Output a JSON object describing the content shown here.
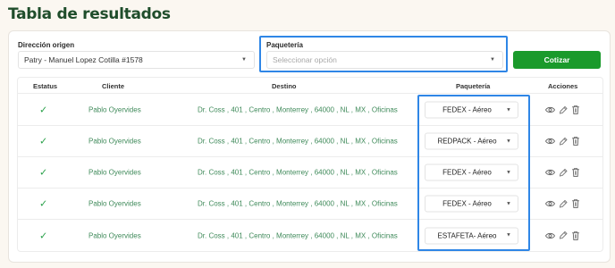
{
  "page": {
    "title": "Tabla de resultados"
  },
  "form": {
    "origin_label": "Dirección origen",
    "origin_value": "Patry - Manuel Lopez Cotilla #1578",
    "package_label": "Paquetería",
    "package_placeholder": "Seleccionar opción",
    "quote_button": "Cotizar"
  },
  "table": {
    "headers": {
      "status": "Estatus",
      "client": "Cliente",
      "destination": "Destino",
      "package": "Paquetería",
      "actions": "Acciones"
    },
    "rows": [
      {
        "status_icon": "check-icon",
        "client": "Pablo Oyervides",
        "destination": "Dr. Coss , 401 , Centro , Monterrey , 64000 , NL , MX , Oficinas",
        "package": "FEDEX - Aéreo"
      },
      {
        "status_icon": "check-icon",
        "client": "Pablo Oyervides",
        "destination": "Dr. Coss , 401 , Centro , Monterrey , 64000 , NL , MX , Oficinas",
        "package": "REDPACK - Aéreo"
      },
      {
        "status_icon": "check-icon",
        "client": "Pablo Oyervides",
        "destination": "Dr. Coss , 401 , Centro , Monterrey , 64000 , NL , MX , Oficinas",
        "package": "FEDEX - Aéreo"
      },
      {
        "status_icon": "check-icon",
        "client": "Pablo Oyervides",
        "destination": "Dr. Coss , 401 , Centro , Monterrey , 64000 , NL , MX , Oficinas",
        "package": "FEDEX - Aéreo"
      },
      {
        "status_icon": "check-icon",
        "client": "Pablo Oyervides",
        "destination": "Dr. Coss , 401 , Centro , Monterrey , 64000 , NL , MX , Oficinas",
        "package": "ESTAFETA- Aéreo"
      }
    ],
    "row_actions": [
      "eye-icon",
      "pencil-icon",
      "trash-icon"
    ]
  },
  "colors": {
    "accent": "#1a9a2b",
    "title": "#1f4d2b",
    "highlight": "#2f86e6",
    "link_text": "#3f8a5a"
  }
}
